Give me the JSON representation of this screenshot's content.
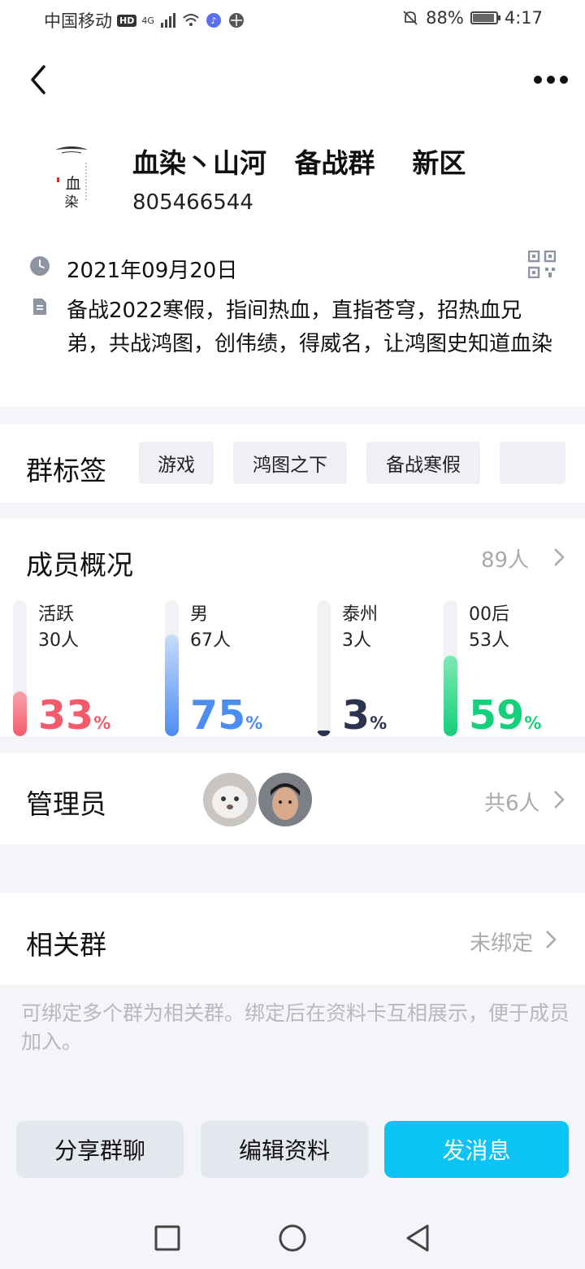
{
  "status_bar": {
    "carrier": "中国移动",
    "hd": "HD",
    "network": "4G",
    "battery": "88%",
    "time": "4:17"
  },
  "header": {
    "group_name": "血染丶山河   备战群    新区",
    "group_id": "805466544",
    "logo_text": "血染"
  },
  "info": {
    "date": "2021年09月20日",
    "description": "备战2022寒假，指间热血，直指苍穹，招热血兄弟，共战鸿图，创伟绩，得威名，让鸿图史知道血染"
  },
  "tags": {
    "title": "群标签",
    "items": [
      "游戏",
      "鸿图之下",
      "备战寒假",
      ""
    ]
  },
  "members": {
    "title": "成员概况",
    "count": "89人",
    "stats": [
      {
        "label": "活跃",
        "count": "30人",
        "percent": "33",
        "unit": "%",
        "color": "#f35b6b",
        "fraction": 0.33
      },
      {
        "label": "男",
        "count": "67人",
        "percent": "75",
        "unit": "%",
        "color": "#4c8df2",
        "fraction": 0.75
      },
      {
        "label": "泰州",
        "count": "3人",
        "percent": "3",
        "unit": "%",
        "color": "#2a3450",
        "fraction": 0.03
      },
      {
        "label": "00后",
        "count": "53人",
        "percent": "59",
        "unit": "%",
        "color": "#15cf7a",
        "fraction": 0.59
      }
    ]
  },
  "admins": {
    "title": "管理员",
    "count": "共6人"
  },
  "related": {
    "title": "相关群",
    "status": "未绑定",
    "hint": "可绑定多个群为相关群。绑定后在资料卡互相展示，便于成员加入。"
  },
  "buttons": {
    "share": "分享群聊",
    "edit": "编辑资料",
    "message": "发消息"
  },
  "colors": {
    "primary": "#0bc4f5"
  }
}
